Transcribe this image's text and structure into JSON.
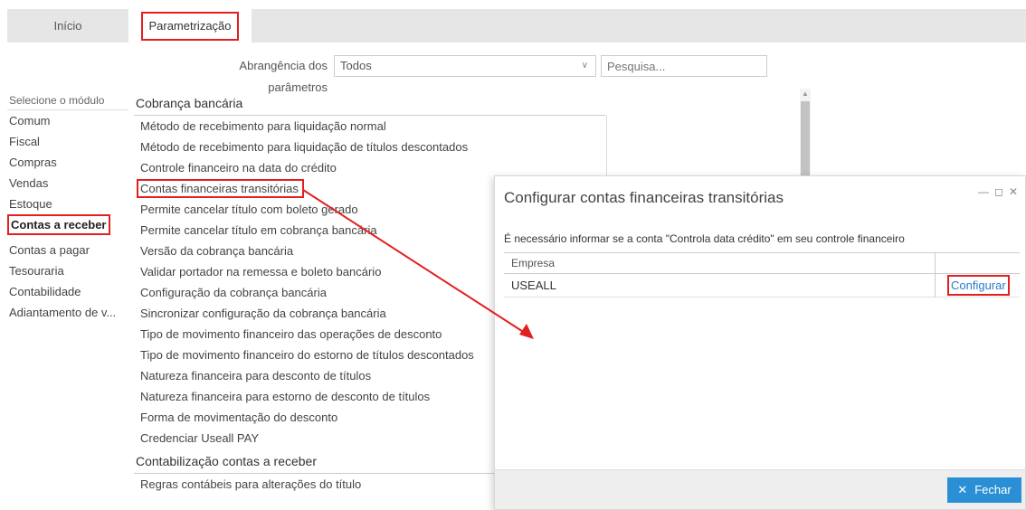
{
  "tabs": {
    "home": "Início",
    "params": "Parametrização"
  },
  "filter": {
    "label": "Abrangência dos parâmetros",
    "select_value": "Todos",
    "search_placeholder": "Pesquisa..."
  },
  "sidebar": {
    "title": "Selecione o módulo",
    "items": [
      "Comum",
      "Fiscal",
      "Compras",
      "Vendas",
      "Estoque",
      "Contas a receber",
      "Contas a pagar",
      "Tesouraria",
      "Contabilidade",
      "Adiantamento de v..."
    ],
    "active_index": 5
  },
  "params": {
    "group1": "Cobrança bancária",
    "items1": [
      "Método de recebimento para liquidação normal",
      "Método de recebimento para liquidação de títulos descontados",
      "Controle financeiro na data do crédito",
      "Contas financeiras transitórias",
      "Permite cancelar título com boleto gerado",
      "Permite cancelar título em cobrança bancária",
      "Versão da cobrança bancária",
      "Validar portador na remessa e boleto bancário",
      "Configuração da cobrança bancária",
      "Sincronizar configuração da cobrança bancária",
      "Tipo de movimento financeiro das operações de desconto",
      "Tipo de movimento financeiro do estorno de títulos descontados",
      "Natureza financeira para desconto de títulos",
      "Natureza financeira para estorno de desconto de títulos",
      "Forma de movimentação do desconto",
      "Credenciar Useall PAY"
    ],
    "group2": "Contabilização contas a receber",
    "items2": [
      "Regras contábeis para alterações do título"
    ]
  },
  "dialog": {
    "title": "Configurar contas financeiras transitórias",
    "message": "É necessário informar se a conta \"Controla data crédito\" em seu controle financeiro",
    "column_header": "Empresa",
    "row_company": "USEALL",
    "row_action": "Configurar",
    "close_label": "Fechar"
  },
  "colors": {
    "highlight": "#e32020",
    "primary_button": "#2b8fd6",
    "link": "#2a7cc7"
  }
}
